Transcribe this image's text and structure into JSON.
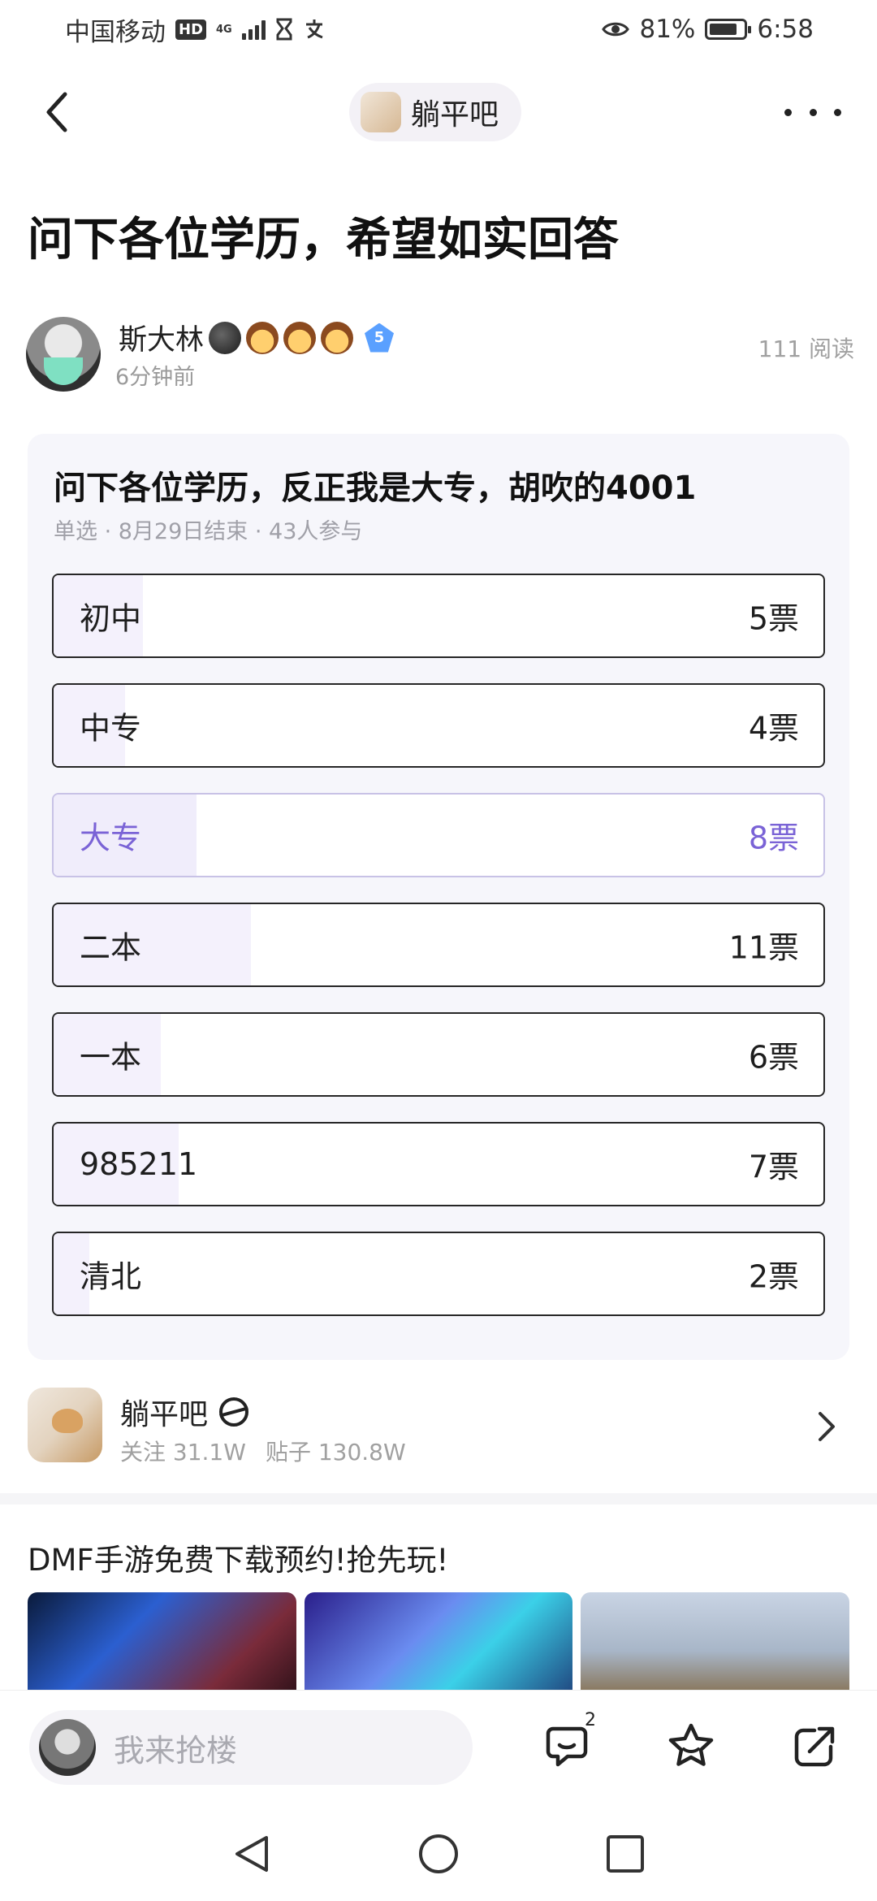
{
  "status_bar": {
    "carrier": "中国移动",
    "hd": "HD",
    "network": "4G",
    "battery": "81%",
    "battery_level": 0.81,
    "time": "6:58"
  },
  "header": {
    "forum_name": "躺平吧"
  },
  "post": {
    "title": "问下各位学历，希望如实回答",
    "author": {
      "name": "斯大林",
      "level": "5",
      "time": "6分钟前"
    },
    "read_count": "111 阅读"
  },
  "poll": {
    "title": "问下各位学历，反正我是大专，胡吹的4001",
    "meta": "单选 · 8月29日结束 · 43人参与",
    "options": [
      {
        "label": "初中",
        "votes": "5票",
        "count": 5,
        "selected": false
      },
      {
        "label": "中专",
        "votes": "4票",
        "count": 4,
        "selected": false
      },
      {
        "label": "大专",
        "votes": "8票",
        "count": 8,
        "selected": true
      },
      {
        "label": "二本",
        "votes": "11票",
        "count": 11,
        "selected": false
      },
      {
        "label": "一本",
        "votes": "6票",
        "count": 6,
        "selected": false
      },
      {
        "label": "985211",
        "votes": "7票",
        "count": 7,
        "selected": false
      },
      {
        "label": "清北",
        "votes": "2票",
        "count": 2,
        "selected": false
      }
    ],
    "total": 43,
    "accent_color": "#7a63d6"
  },
  "forum_card": {
    "name": "躺平吧",
    "followers": "关注 31.1W",
    "posts": "贴子 130.8W"
  },
  "ad": {
    "title": "DMF手游免费下载预约!抢先玩!"
  },
  "bottom_bar": {
    "placeholder": "我来抢楼",
    "comment_count": "2"
  },
  "icons": {
    "back": "chevron-left-icon",
    "more": "more-dots-icon",
    "comment": "comment-icon",
    "favorite": "star-icon",
    "share": "share-icon",
    "nav_back": "triangle-back-icon",
    "nav_home": "circle-home-icon",
    "nav_recent": "square-recent-icon"
  }
}
